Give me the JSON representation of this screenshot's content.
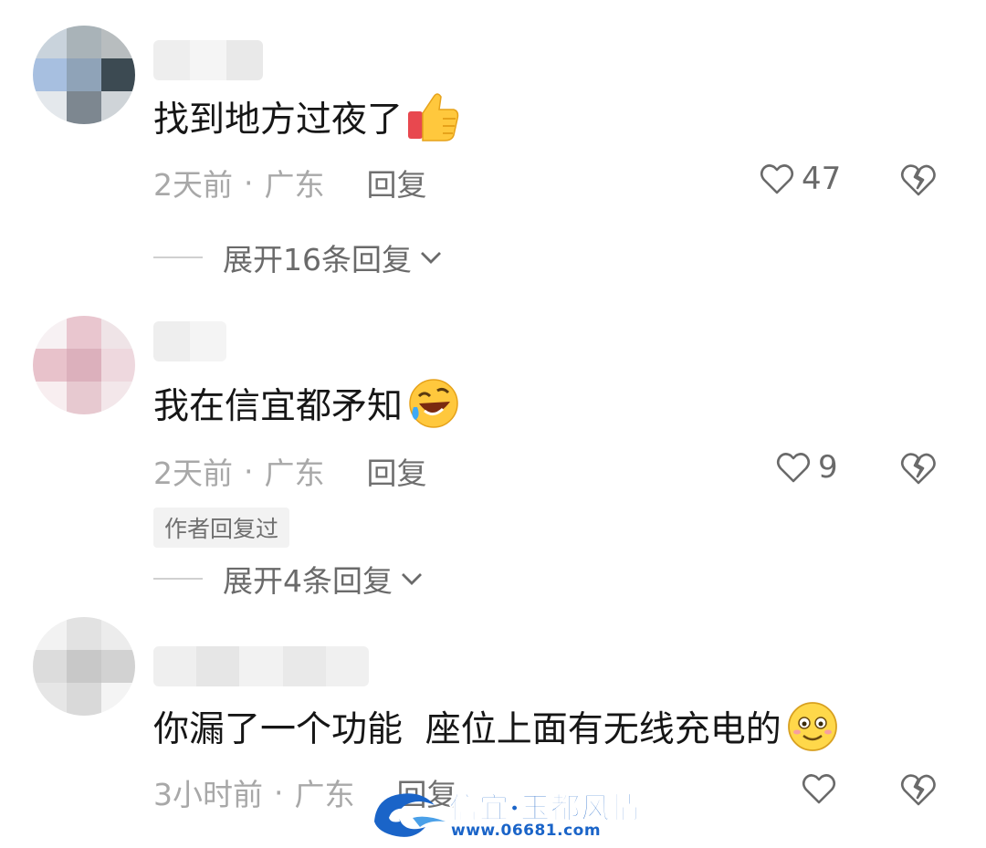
{
  "comments": [
    {
      "text": "找到地方过夜了",
      "emoji": "thumbs-up",
      "time": "2天前",
      "location": "广东",
      "reply_label": "回复",
      "like_count": "47",
      "expand_label": "展开16条回复"
    },
    {
      "text": "我在信宜都矛知",
      "emoji": "rolling-laughing",
      "time": "2天前",
      "location": "广东",
      "reply_label": "回复",
      "like_count": "9",
      "badge": "作者回复过",
      "expand_label": "展开4条回复"
    },
    {
      "text": "你漏了一个功能  座位上面有无线充电的",
      "emoji": "smiling-face",
      "time": "3小时前",
      "location": "广东",
      "reply_label": "回复",
      "like_count": ""
    }
  ],
  "separator": "·",
  "watermark": {
    "title": "信宜·玉都风情",
    "url": "www.06681.com"
  },
  "colors": {
    "text": "#161616",
    "meta": "#a8a8a8",
    "watermark": "#1a64c8"
  }
}
